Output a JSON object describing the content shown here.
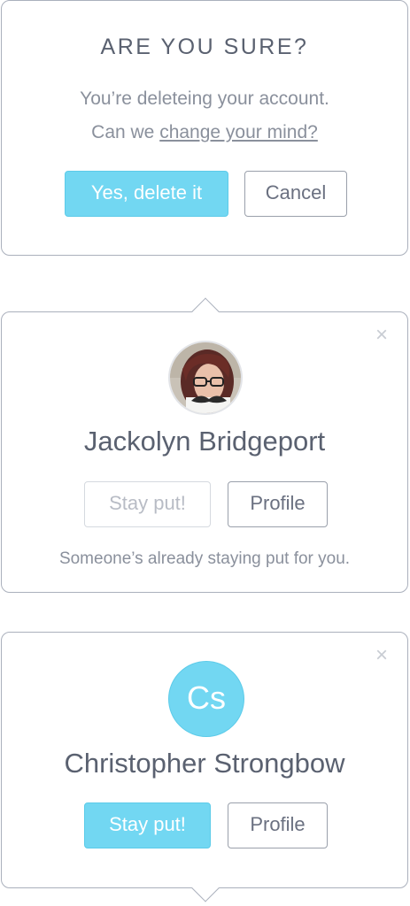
{
  "confirm_dialog": {
    "title": "ARE YOU SURE?",
    "message_line1": "You’re deleteing your account.",
    "message_prefix": "Can we ",
    "message_link": "change your mind?",
    "confirm_label": "Yes, delete it",
    "cancel_label": "Cancel"
  },
  "profile_card_1": {
    "close_glyph": "×",
    "name": "Jackolyn Bridgeport",
    "stay_label": "Stay put!",
    "profile_label": "Profile",
    "note": "Someone’s already staying put for you."
  },
  "profile_card_2": {
    "close_glyph": "×",
    "initials": "Cs",
    "name": "Christopher Strongbow",
    "stay_label": "Stay put!",
    "profile_label": "Profile"
  },
  "colors": {
    "accent": "#72d7f2",
    "border": "#aab0bc",
    "text": "#5a6170",
    "muted_text": "#8a909c"
  }
}
